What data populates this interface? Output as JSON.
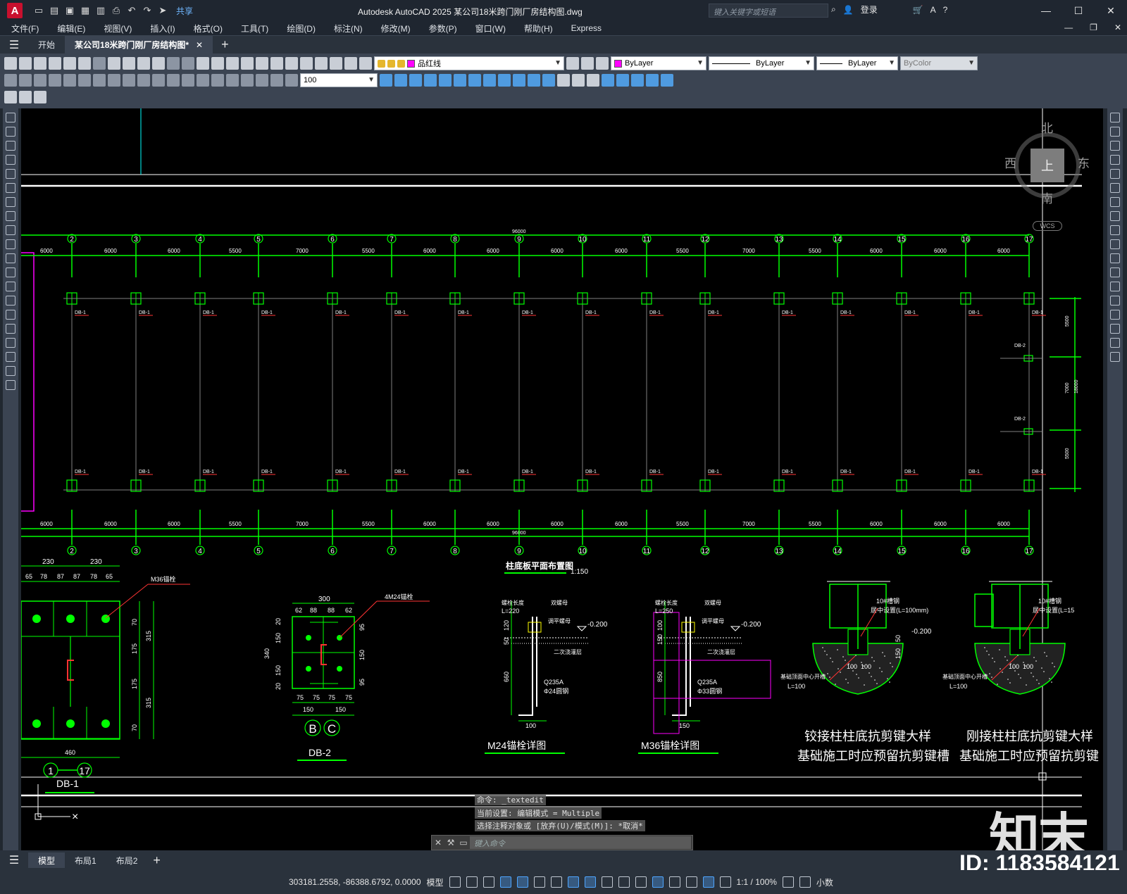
{
  "titlebar": {
    "app_logo": "A",
    "share_label": "共享",
    "title": "Autodesk AutoCAD 2025    某公司18米跨门刚厂房结构图.dwg",
    "search_placeholder": "键入关键字或短语",
    "login_label": "登录"
  },
  "menu": [
    "文件(F)",
    "编辑(E)",
    "视图(V)",
    "插入(I)",
    "格式(O)",
    "工具(T)",
    "绘图(D)",
    "标注(N)",
    "修改(M)",
    "参数(P)",
    "窗口(W)",
    "帮助(H)",
    "Express"
  ],
  "tabs": [
    {
      "label": "开始"
    },
    {
      "label": "某公司18米跨门刚厂房结构图*"
    }
  ],
  "toolbar": {
    "layer_name": "品红线",
    "color_combo": "ByLayer",
    "linetype_combo": "ByLayer",
    "lineweight_combo": "ByLayer",
    "plotstyle_combo": "ByColor",
    "dimscale_value": "100",
    "layer_color": "#ff00ff"
  },
  "viewcube": {
    "north": "北",
    "south": "南",
    "east": "东",
    "west": "西",
    "face": "上",
    "wcs": "WCS"
  },
  "drawing": {
    "grid_axes": [
      "2",
      "3",
      "4",
      "5",
      "6",
      "7",
      "8",
      "9",
      "10",
      "11",
      "12",
      "13",
      "14",
      "15",
      "16",
      "17"
    ],
    "spacings": [
      "6000",
      "6000",
      "6000",
      "5500",
      "7000",
      "5500",
      "6000",
      "6000",
      "6000",
      "6000",
      "5500",
      "7000",
      "5500",
      "6000",
      "6000",
      "6000"
    ],
    "total_length": "96000",
    "plan_title": "柱底板平面布置图",
    "plan_scale": "1:150",
    "db1_label": "DB-1",
    "db2_label": "DB-2",
    "right_dims": [
      "5500",
      "7000",
      "5500"
    ],
    "right_total": "18000",
    "db1_detail": {
      "top_dims": [
        "230",
        "230"
      ],
      "sub_dims": [
        "65",
        "78",
        "87",
        "87",
        "78",
        "65"
      ],
      "bottom_dim": "460",
      "side_dims": [
        "70",
        "175",
        "175",
        "70"
      ],
      "side_totals": [
        "315",
        "315"
      ],
      "bolt_note": "M36锚栓",
      "axis_range": [
        "1",
        "17"
      ],
      "title": "DB-1"
    },
    "db2_detail": {
      "top_dim": "300",
      "sub_dims": [
        "62",
        "88",
        "88",
        "62"
      ],
      "left_dim": "340",
      "left_subs": [
        "20",
        "150",
        "150",
        "20"
      ],
      "right_subs": [
        "95",
        "150",
        "95"
      ],
      "bottom_subs": [
        "75",
        "75",
        "75",
        "75"
      ],
      "bottom_halves": [
        "150",
        "150"
      ],
      "bolt_note": "4M24锚栓",
      "axis_marks": [
        "B",
        "C"
      ],
      "title": "DB-2"
    },
    "m24_detail": {
      "labels": [
        "螺栓长度",
        "L=220",
        "双螺母",
        "调平螺母",
        "二次浇灌层",
        "Q235A",
        "Φ24圆钢"
      ],
      "level": "-0.200",
      "dims": [
        "120",
        "50",
        "660",
        "100"
      ],
      "title": "M24锚栓详图"
    },
    "m36_detail": {
      "labels": [
        "螺栓长度",
        "L=250",
        "双螺母",
        "调平螺母",
        "二次浇灌层",
        "Q235A",
        "Φ33圆钢"
      ],
      "level": "-0.200",
      "dims": [
        "100",
        "150",
        "850",
        "150"
      ],
      "title": "M36锚栓详图"
    },
    "hinge_detail": {
      "labels": [
        "10#槽钢",
        "居中设置(L=100mm)",
        "基础顶面中心开槽",
        "L=100"
      ],
      "level": "-0.200",
      "dims": [
        "100",
        "100",
        "50",
        "150"
      ],
      "title1": "铰接柱柱底抗剪键大样",
      "title2": "基础施工时应预留抗剪键槽"
    },
    "rigid_detail": {
      "labels": [
        "10#槽钢",
        "居中设置(L=15",
        "基础顶面中心开槽",
        "L=100"
      ],
      "dims": [
        "100",
        "100"
      ],
      "title1": "刚接柱柱底抗剪键大样",
      "title2": "基础施工时应预留抗剪键"
    }
  },
  "command": {
    "history": [
      "命令: _textedit",
      "当前设置: 编辑模式 = Multiple",
      "选择注释对象或 [放弃(U)/模式(M)]: *取消*"
    ],
    "prompt_placeholder": "键入命令"
  },
  "layout_tabs": [
    "模型",
    "布局1",
    "布局2"
  ],
  "status": {
    "coordinates": "303181.2558, -86388.6792, 0.0000",
    "model_label": "模型",
    "annoscale": "1:1 / 100%",
    "units": "小数"
  },
  "watermark": {
    "logo": "知末",
    "id": "ID: 1183584121"
  }
}
